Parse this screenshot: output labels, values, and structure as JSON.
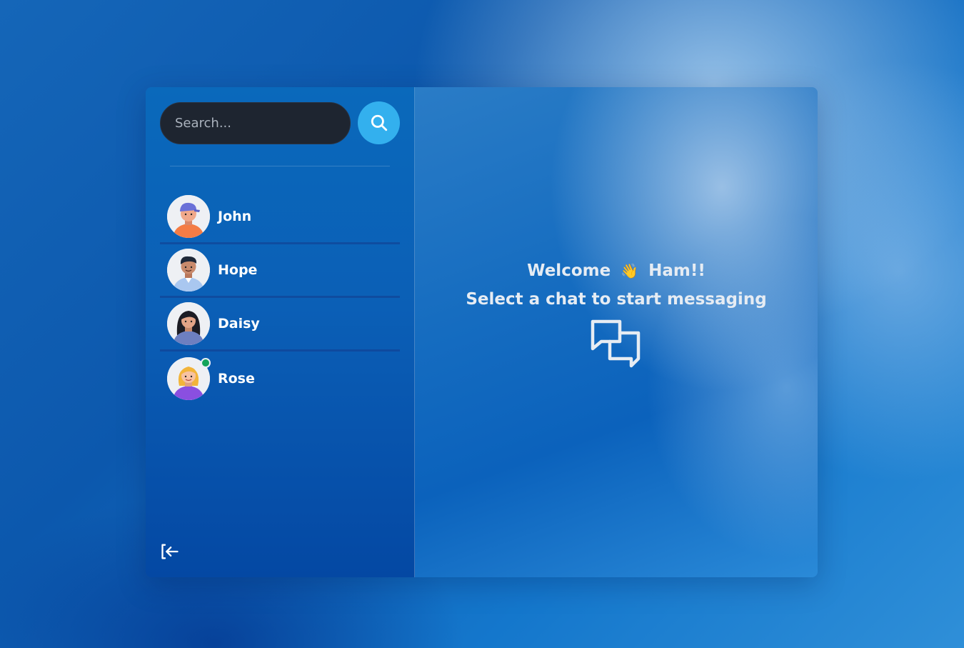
{
  "search": {
    "placeholder": "Search..."
  },
  "contacts": [
    {
      "name": "John",
      "online": false
    },
    {
      "name": "Hope",
      "online": false
    },
    {
      "name": "Daisy",
      "online": false
    },
    {
      "name": "Rose",
      "online": true
    }
  ],
  "welcome": {
    "greeting": "Welcome",
    "emoji": "👋",
    "user": "Ham!!",
    "subtitle": "Select a chat to start messaging"
  },
  "icons": {
    "search": "search-icon",
    "logout": "logout-icon",
    "chat": "chat-bubbles-icon"
  },
  "colors": {
    "search_button": "#33b0ee",
    "search_input_bg": "#1e2530",
    "online": "#12a35a"
  }
}
